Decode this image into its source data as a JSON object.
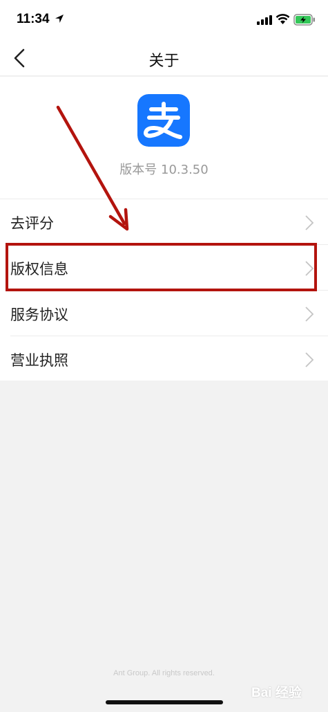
{
  "status_bar": {
    "time": "11:34"
  },
  "nav": {
    "title": "关于"
  },
  "app": {
    "version": "版本号 10.3.50",
    "logo_char": "支",
    "brand_color": "#1677ff"
  },
  "menu": {
    "items": [
      {
        "label": "去评分"
      },
      {
        "label": "版权信息"
      },
      {
        "label": "服务协议"
      },
      {
        "label": "营业执照"
      }
    ]
  },
  "footer": {
    "copyright": "Ant Group. All rights reserved."
  },
  "watermark": {
    "text": "Bai 经验"
  },
  "annotation": {
    "color": "#b3140e"
  }
}
